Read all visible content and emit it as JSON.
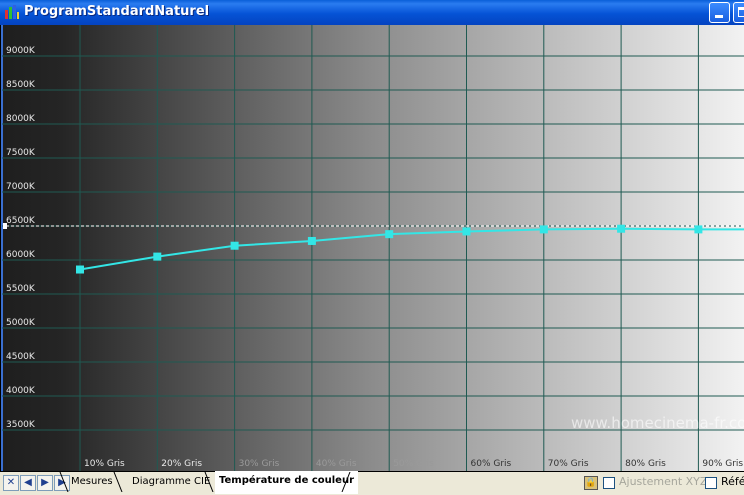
{
  "window": {
    "title": "ProgramStandardNaturel",
    "controls": [
      "minimize",
      "maximize"
    ]
  },
  "watermark": "www.homecinema-fr.com",
  "chart_data": {
    "type": "line",
    "ylim": [
      3200,
      9500
    ],
    "y_ticks": [
      3500,
      4000,
      4500,
      5000,
      5500,
      6000,
      6500,
      7000,
      7500,
      8000,
      8500,
      9000
    ],
    "y_tick_labels": [
      "3500K",
      "4000K",
      "4500K",
      "5000K",
      "5500K",
      "6000K",
      "6500K",
      "7000K",
      "7500K",
      "8000K",
      "8500K",
      "9000K"
    ],
    "x_tick_labels": [
      "10% Gris",
      "20% Gris",
      "30% Gris",
      "40% Gris",
      "50% Gris",
      "60% Gris",
      "70% Gris",
      "80% Gris",
      "90% Gris"
    ],
    "reference_line": 6500,
    "series": [
      {
        "color": "#33e6e6",
        "x": [
          "10% Gris",
          "20% Gris",
          "30% Gris",
          "40% Gris",
          "50% Gris",
          "60% Gris",
          "70% Gris",
          "80% Gris",
          "90% Gris"
        ],
        "values": [
          5860,
          6050,
          6210,
          6280,
          6380,
          6420,
          6450,
          6460,
          6450
        ]
      }
    ],
    "grid": true
  },
  "tabs": {
    "nav_buttons": [
      "first",
      "prev",
      "next",
      "last"
    ],
    "items": [
      {
        "label": "Mesures",
        "active": false
      },
      {
        "label": "Diagramme CIE",
        "active": false
      },
      {
        "label": "Température de couleur",
        "active": true
      }
    ]
  },
  "status": {
    "adjust_label": "Ajustement XYZ",
    "ref_label": "Réfé"
  }
}
